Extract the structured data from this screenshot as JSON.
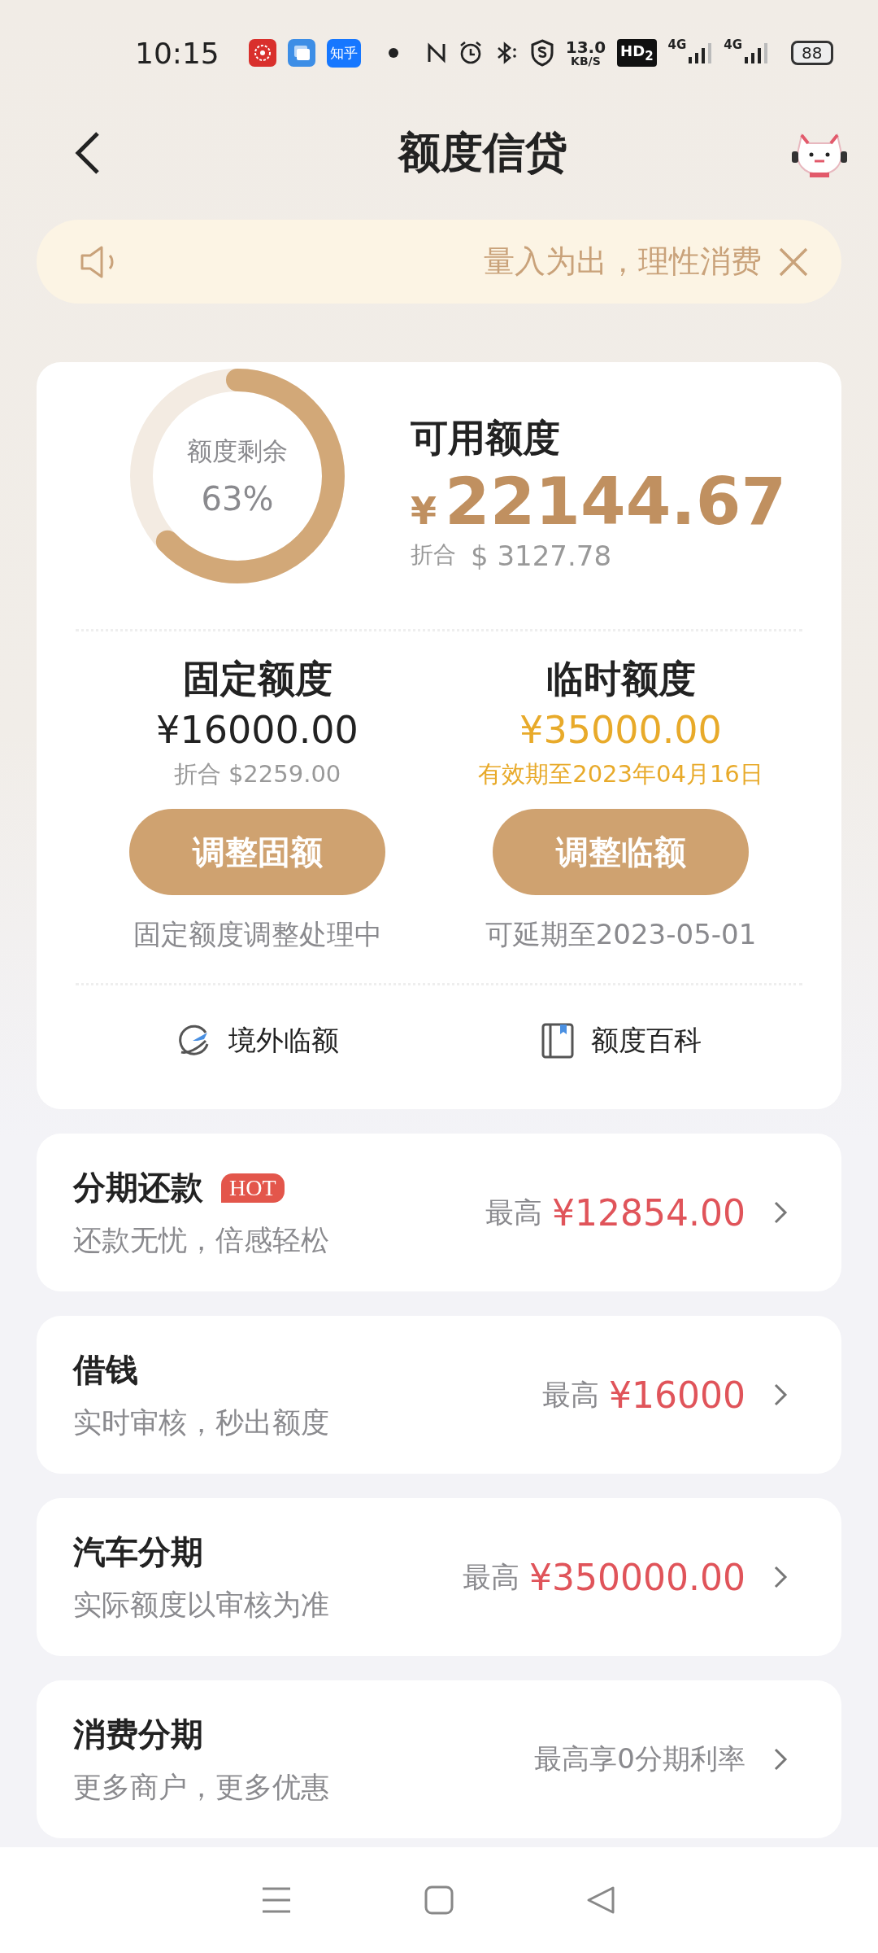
{
  "status_bar": {
    "time": "10:15",
    "app_badge": "知乎",
    "speed": "13.0",
    "speed_unit": "KB/S",
    "hd": "HD$_{2}$",
    "networks": [
      "4G",
      "4G"
    ],
    "battery": "88"
  },
  "header": {
    "title": "额度信贷"
  },
  "notice": {
    "text": "量入为出，理性消费"
  },
  "summary": {
    "ring_label": "额度剩余",
    "ring_percent": "63%",
    "level": 0.63,
    "title": "可用额度",
    "currency": "¥",
    "amount": "22144.67",
    "converted_label": "折合",
    "converted": "$ 3127.78"
  },
  "limits": [
    {
      "kind": "fixed",
      "title": "固定额度",
      "amount": "¥16000.00",
      "note": "折合 $2259.00",
      "button": "调整固额",
      "status": "固定额度调整处理中"
    },
    {
      "kind": "temporary",
      "title": "临时额度",
      "amount": "¥35000.00",
      "note": "有效期至2023年04月16日",
      "button": "调整临额",
      "status": "可延期至2023-05-01"
    }
  ],
  "links": [
    {
      "label": "境外临额"
    },
    {
      "label": "额度百科"
    }
  ],
  "products": [
    {
      "kind": "amount",
      "title": "分期还款",
      "badge": "HOT",
      "subtitle": "还款无忧，倍感轻松",
      "prefix": "最高",
      "value": "¥12854.00"
    },
    {
      "kind": "amount",
      "title": "借钱",
      "subtitle": "实时审核，秒出额度",
      "prefix": "最高",
      "value": "¥16000"
    },
    {
      "kind": "amount",
      "title": "汽车分期",
      "subtitle": "实际额度以审核为准",
      "prefix": "最高",
      "value": "¥350000.00"
    },
    {
      "kind": "offer",
      "title": "消费分期",
      "subtitle": "更多商户，更多优惠",
      "value": "最高享0分期利率"
    }
  ]
}
